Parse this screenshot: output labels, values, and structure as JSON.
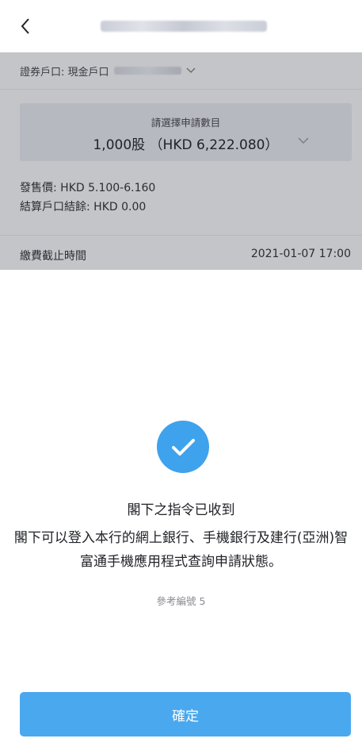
{
  "account": {
    "label": "證券戶口: 現金戶口"
  },
  "application": {
    "select_prompt": "請選擇申請數目",
    "selected_value": "1,000股 （HKD 6,222.080）",
    "offer_price": "發售價: HKD 5.100-6.160",
    "settlement_balance": "結算戶口結餘: HKD 0.00",
    "deadline_label": "繳費截止時間",
    "deadline_value": "2021-01-07 17:00"
  },
  "result": {
    "title": "閣下之指令已收到",
    "body": "閣下可以登入本行的網上銀行、手機銀行及建行(亞洲)智富通手機應用程式查詢申請狀態。",
    "reference": "參考編號 5"
  },
  "actions": {
    "confirm_label": "確定"
  },
  "colors": {
    "accent": "#4aa8ee",
    "check_circle": "#3fa2ec",
    "overlay": "#c4c5c9"
  },
  "icons": {
    "back": "chevron-left-icon",
    "dropdown": "chevron-down-icon",
    "success": "checkmark-icon"
  }
}
